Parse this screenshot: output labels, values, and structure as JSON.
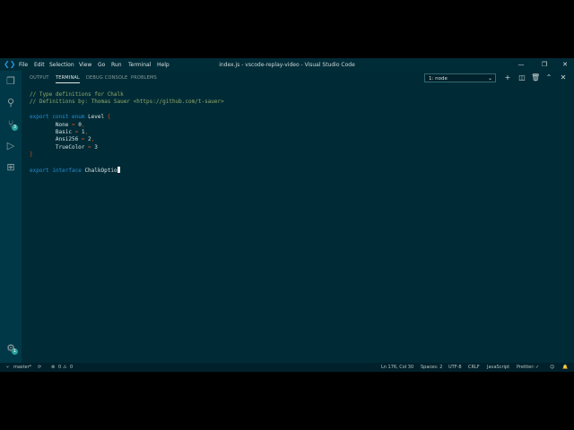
{
  "window": {
    "title": "index.js - vscode-replay-video - Visual Studio Code"
  },
  "menu": [
    "File",
    "Edit",
    "Selection",
    "View",
    "Go",
    "Run",
    "Terminal",
    "Help"
  ],
  "panel": {
    "tabs": [
      "OUTPUT",
      "TERMINAL",
      "DEBUG CONSOLE",
      "PROBLEMS"
    ],
    "active_tab": "TERMINAL",
    "terminal_select": "1: node"
  },
  "activity": {
    "scm_badge": "3",
    "settings_badge": "1"
  },
  "code_lines": [
    [
      [
        "c",
        "// Type definitions for Chalk"
      ]
    ],
    [
      [
        "c",
        "// Definitions by: Thomas Sauer <https://github.com/t-sauer>"
      ]
    ],
    [],
    [
      [
        "k",
        "export"
      ],
      [
        "n",
        " "
      ],
      [
        "k",
        "const"
      ],
      [
        "n",
        " "
      ],
      [
        "k",
        "enum"
      ],
      [
        "n",
        " Level "
      ],
      [
        "p",
        "{"
      ]
    ],
    [
      [
        "n",
        "        None "
      ],
      [
        "p",
        "="
      ],
      [
        "n",
        " 0"
      ],
      [
        "p",
        ","
      ]
    ],
    [
      [
        "n",
        "        Basic "
      ],
      [
        "p",
        "="
      ],
      [
        "n",
        " 1"
      ],
      [
        "p",
        ","
      ]
    ],
    [
      [
        "n",
        "        Ansi256 "
      ],
      [
        "p",
        "="
      ],
      [
        "n",
        " 2"
      ],
      [
        "p",
        ","
      ]
    ],
    [
      [
        "n",
        "        TrueColor "
      ],
      [
        "p",
        "="
      ],
      [
        "n",
        " 3"
      ]
    ],
    [
      [
        "p",
        "}"
      ]
    ],
    [],
    [
      [
        "k",
        "export"
      ],
      [
        "n",
        " "
      ],
      [
        "k",
        "interface"
      ],
      [
        "n",
        " ChalkOptio"
      ]
    ]
  ],
  "status": {
    "branch": "master*",
    "problems": "0",
    "warnings": "0",
    "position": "Ln 176, Col 30",
    "spaces": "Spaces: 2",
    "encoding": "UTF-8",
    "eol": "CRLF",
    "language": "JavaScript",
    "formatter": "Prettier:"
  }
}
